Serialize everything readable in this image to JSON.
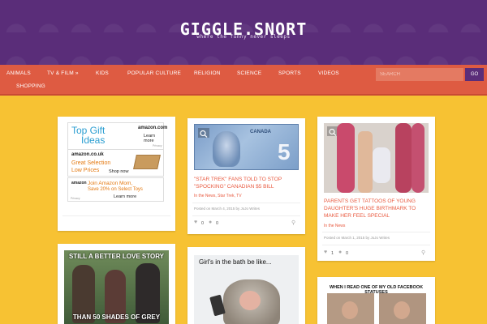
{
  "site": {
    "logo": "GIGGLE.SNORT",
    "tagline": "where the funny never sleeps"
  },
  "nav": {
    "items": [
      {
        "label": "ANIMALS"
      },
      {
        "label": "TV & FILM »"
      },
      {
        "label": "KIDS"
      },
      {
        "label": "POPULAR CULTURE"
      },
      {
        "label": "RELIGION"
      },
      {
        "label": "SCIENCE"
      },
      {
        "label": "SPORTS"
      },
      {
        "label": "VIDEOS"
      },
      {
        "label": "SHOPPING"
      }
    ],
    "search_placeholder": "SEARCH",
    "go_label": "GO"
  },
  "ad": {
    "top_gift_line1": "Top Gift",
    "top_gift_line2": "Ideas",
    "amazon_com": "amazon.com",
    "learn_more_1": "Learn more",
    "privacy_1": "Privacy",
    "amazon_couk": "amazon.co.uk",
    "great_selection": "Great Selection",
    "low_prices": "Low Prices",
    "shop_now": "Shop now",
    "amazon": "amazon",
    "mom_line1": "Join Amazon Mom,",
    "mom_line2": "Save 20% on Select Toys",
    "learn_more_2": "Learn more",
    "privacy_2": "Privacy"
  },
  "posts": [
    {
      "title": "\"STAR TREK\" FANS TOLD TO STOP \"SPOCKING\" CANADIAN $5 BILL",
      "categories": "In the News, Star Trek, TV",
      "meta": "Posted on March 4, 2015 by JoJo Writes",
      "likes": "0",
      "comments": "0",
      "banknote_country": "CANADA",
      "banknote_value": "5"
    },
    {
      "title": "PARENTS GET TATTOOS OF YOUNG DAUGHTER'S HUGE BIRTHMARK TO MAKE HER FEEL SPECIAL",
      "categories": "In the News",
      "meta": "Posted on March 1, 2015 by JoJo Writes",
      "likes": "1",
      "comments": "0"
    }
  ],
  "memes": {
    "love_story_top": "STILL A BETTER LOVE STORY",
    "love_story_bottom": "THAN 50 SHADES OF GREY",
    "bath_caption": "Girl's in the bath be like...",
    "facebook_caption": "WHEN I READ ONE OF MY OLD FACEBOOK STATUSES"
  }
}
